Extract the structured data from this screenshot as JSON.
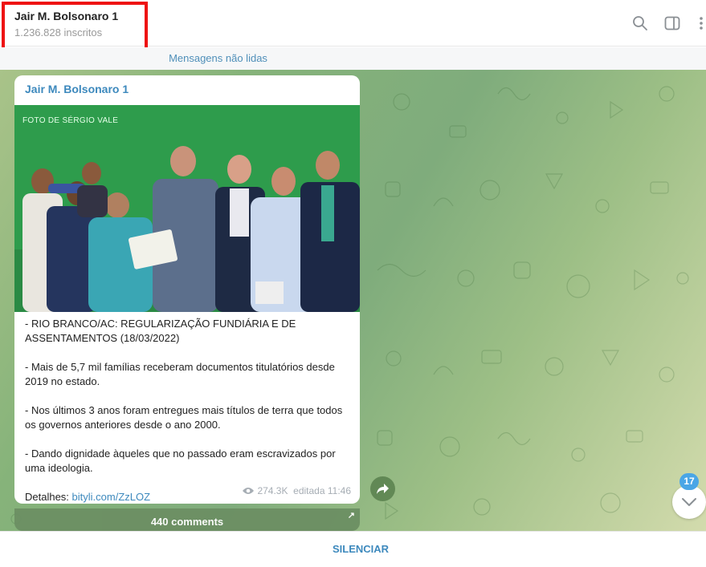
{
  "header": {
    "title": "Jair M. Bolsonaro 1",
    "subscribers": "1.236.828 inscritos",
    "icons": [
      "search-icon",
      "sidebar-toggle-icon",
      "more-vertical-icon"
    ]
  },
  "unread_bar": {
    "label": "Mensagens não lidas"
  },
  "message": {
    "author": "Jair M. Bolsonaro 1",
    "photo_credit": "FOTO DE SÉRGIO VALE",
    "paragraphs": [
      "- RIO BRANCO/AC: REGULARIZAÇÃO FUNDIÁRIA E DE ASSENTAMENTOS (18/03/2022)",
      "- Mais de 5,7 mil famílias receberam documentos titulatórios desde 2019 no estado.",
      "- Nos últimos 3 anos foram entregues mais títulos de terra que todos os governos anteriores desde o ano 2000.",
      "- Dando dignidade àqueles que no passado eram escravizados por uma ideologia."
    ],
    "details_prefix": "Detalhes: ",
    "details_link": "bityli.com/ZzLOZ",
    "views": "274.3K",
    "edited_time": "editada 11:46"
  },
  "comments": {
    "label": "440 comments"
  },
  "scroll": {
    "unread_count": "17"
  },
  "footer": {
    "mute_label": "SILENCIAR"
  },
  "colors": {
    "accent": "#3d89bd",
    "highlight_box": "#e11111",
    "badge": "#4aa6e6"
  }
}
